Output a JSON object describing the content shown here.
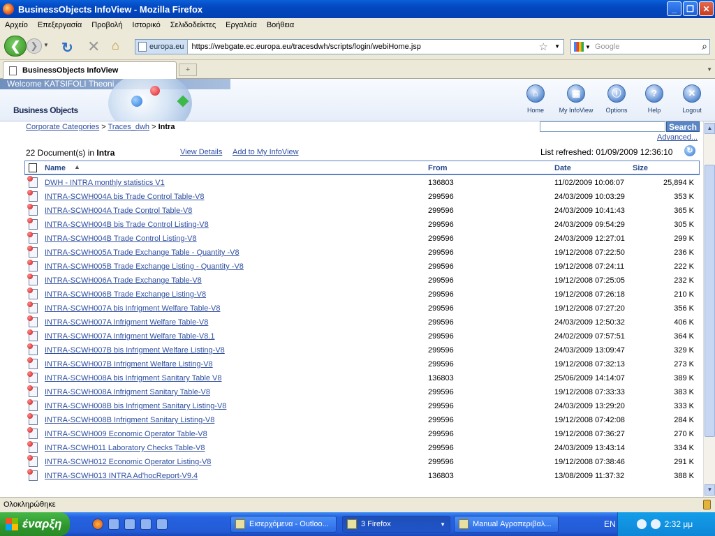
{
  "window": {
    "title": "BusinessObjects InfoView - Mozilla Firefox"
  },
  "menu": [
    "Αρχείο",
    "Επεξεργασία",
    "Προβολή",
    "Ιστορικό",
    "Σελιδοδείκτες",
    "Εργαλεία",
    "Βοήθεια"
  ],
  "nav": {
    "site_id": "europa.eu",
    "url": "https://webgate.ec.europa.eu/tracesdwh/scripts/login/webiHome.jsp",
    "search_placeholder": "Google"
  },
  "tab": {
    "title": "BusinessObjects InfoView"
  },
  "header": {
    "welcome": "Welcome KATSIFOLI Theoni",
    "logo": "Business Objects",
    "buttons": [
      "Home",
      "My InfoView",
      "Options",
      "Help",
      "Logout"
    ]
  },
  "breadcrumb": {
    "item1": "Corporate Categories",
    "sep": ">",
    "item2": "Traces_dwh",
    "current": "Intra"
  },
  "search": {
    "button": "Search",
    "advanced": "Advanced..."
  },
  "summary": {
    "count_text": "22 Document(s) in",
    "folder": "Intra",
    "view_details": "View Details",
    "add_to": "Add to My InfoView",
    "refreshed": "List refreshed: 01/09/2009 12:36:10"
  },
  "table": {
    "columns": {
      "name": "Name",
      "from": "From",
      "date": "Date",
      "size": "Size"
    },
    "rows": [
      {
        "name": "DWH - INTRA monthly statistics V1",
        "from": "136803",
        "date": "11/02/2009 10:06:07",
        "size": "25,894 K"
      },
      {
        "name": "INTRA-SCWH004A bis Trade Control Table-V8",
        "from": "299596",
        "date": "24/03/2009 10:03:29",
        "size": "353 K"
      },
      {
        "name": "INTRA-SCWH004A Trade Control Table-V8",
        "from": "299596",
        "date": "24/03/2009 10:41:43",
        "size": "365 K"
      },
      {
        "name": "INTRA-SCWH004B bis Trade Control Listing-V8",
        "from": "299596",
        "date": "24/03/2009 09:54:29",
        "size": "305 K"
      },
      {
        "name": "INTRA-SCWH004B Trade Control Listing-V8",
        "from": "299596",
        "date": "24/03/2009 12:27:01",
        "size": "299 K"
      },
      {
        "name": "INTRA-SCWH005A Trade Exchange Table - Quantity -V8",
        "from": "299596",
        "date": "19/12/2008 07:22:50",
        "size": "236 K"
      },
      {
        "name": "INTRA-SCWH005B Trade Exchange Listing - Quantity -V8",
        "from": "299596",
        "date": "19/12/2008 07:24:11",
        "size": "222 K"
      },
      {
        "name": "INTRA-SCWH006A Trade Exchange Table-V8",
        "from": "299596",
        "date": "19/12/2008 07:25:05",
        "size": "232 K"
      },
      {
        "name": "INTRA-SCWH006B Trade Exchange Listing-V8",
        "from": "299596",
        "date": "19/12/2008 07:26:18",
        "size": "210 K"
      },
      {
        "name": "INTRA-SCWH007A bis Infrigment Welfare Table-V8",
        "from": "299596",
        "date": "19/12/2008 07:27:20",
        "size": "356 K"
      },
      {
        "name": "INTRA-SCWH007A Infrigment Welfare Table-V8",
        "from": "299596",
        "date": "24/03/2009 12:50:32",
        "size": "406 K"
      },
      {
        "name": "INTRA-SCWH007A Infrigment Welfare Table-V8.1",
        "from": "299596",
        "date": "24/02/2009 07:57:51",
        "size": "364 K"
      },
      {
        "name": "INTRA-SCWH007B bis Infrigment Welfare Listing-V8",
        "from": "299596",
        "date": "24/03/2009 13:09:47",
        "size": "329 K"
      },
      {
        "name": "INTRA-SCWH007B Infrigment Welfare Listing-V8",
        "from": "299596",
        "date": "19/12/2008 07:32:13",
        "size": "273 K"
      },
      {
        "name": "INTRA-SCWH008A bis Infrigment Sanitary Table V8",
        "from": "136803",
        "date": "25/06/2009 14:14:07",
        "size": "389 K"
      },
      {
        "name": "INTRA-SCWH008A Infrigment Sanitary Table-V8",
        "from": "299596",
        "date": "19/12/2008 07:33:33",
        "size": "383 K"
      },
      {
        "name": "INTRA-SCWH008B bis Infrigment Sanitary Listing-V8",
        "from": "299596",
        "date": "24/03/2009 13:29:20",
        "size": "333 K"
      },
      {
        "name": "INTRA-SCWH008B Infrigment Sanitary Listing-V8",
        "from": "299596",
        "date": "19/12/2008 07:42:08",
        "size": "284 K"
      },
      {
        "name": "INTRA-SCWH009 Economic Operator Table-V8",
        "from": "299596",
        "date": "19/12/2008 07:36:27",
        "size": "270 K"
      },
      {
        "name": "INTRA-SCWH011 Laboratory Checks Table-V8",
        "from": "299596",
        "date": "24/03/2009 13:43:14",
        "size": "334 K"
      },
      {
        "name": "INTRA-SCWH012 Economic Operator Listing-V8",
        "from": "299596",
        "date": "19/12/2008 07:38:46",
        "size": "291 K"
      },
      {
        "name": "INTRA-SCWH013 INTRA Ad'hocReport-V9.4",
        "from": "136803",
        "date": "13/08/2009 11:37:32",
        "size": "388 K"
      }
    ]
  },
  "status": {
    "text": "Ολοκληρώθηκε"
  },
  "taskbar": {
    "start": "έναρξη",
    "buttons": [
      "Εισερχόμενα - Outloo...",
      "3 Firefox",
      "Manual Αγροπεριβαλ..."
    ],
    "lang": "EN",
    "clock": "2:32 μμ"
  }
}
